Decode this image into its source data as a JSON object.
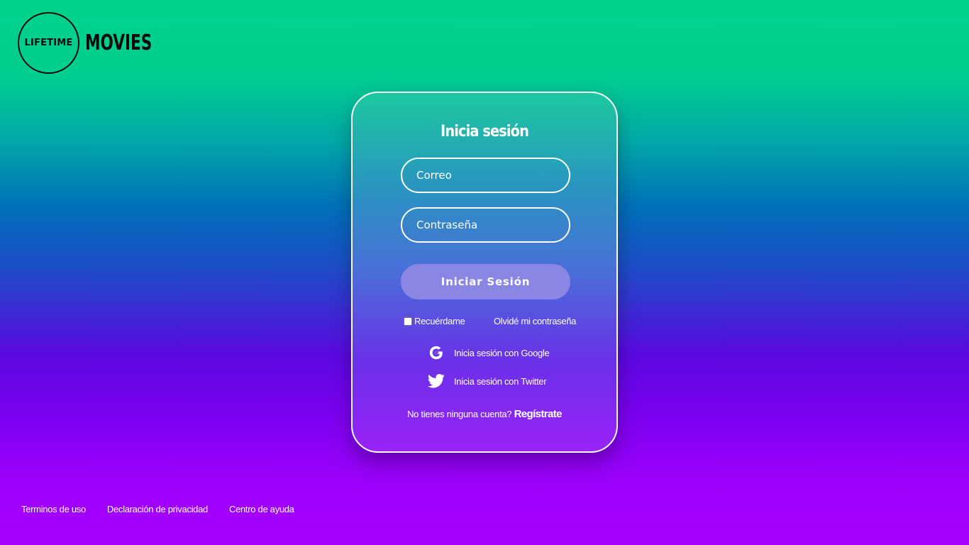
{
  "brand": {
    "circle_text": "LIFETIME",
    "word": "MOVIES"
  },
  "login": {
    "title": "Inicia sesión",
    "email_placeholder": "Correo",
    "password_placeholder": "Contraseña",
    "submit_label": "Iniciar Sesión",
    "remember_label": "Recuérdame",
    "forgot_label": "Olvidé mi contraseña",
    "google_label": "Inicia sesión con Google",
    "google_icon": "google-icon",
    "twitter_label": "Inicia sesión con Twitter",
    "twitter_icon": "twitter-icon",
    "signup_prompt": "No tienes ninguna cuenta?",
    "signup_link": "Regístrate"
  },
  "footer": {
    "links": [
      "Terminos de uso",
      "Declaración de privacidad",
      "Centro de ayuda"
    ]
  },
  "colors": {
    "accent_button": "#8a86e4",
    "gradient_top": "#00d28c",
    "gradient_bottom": "#a600ff"
  }
}
